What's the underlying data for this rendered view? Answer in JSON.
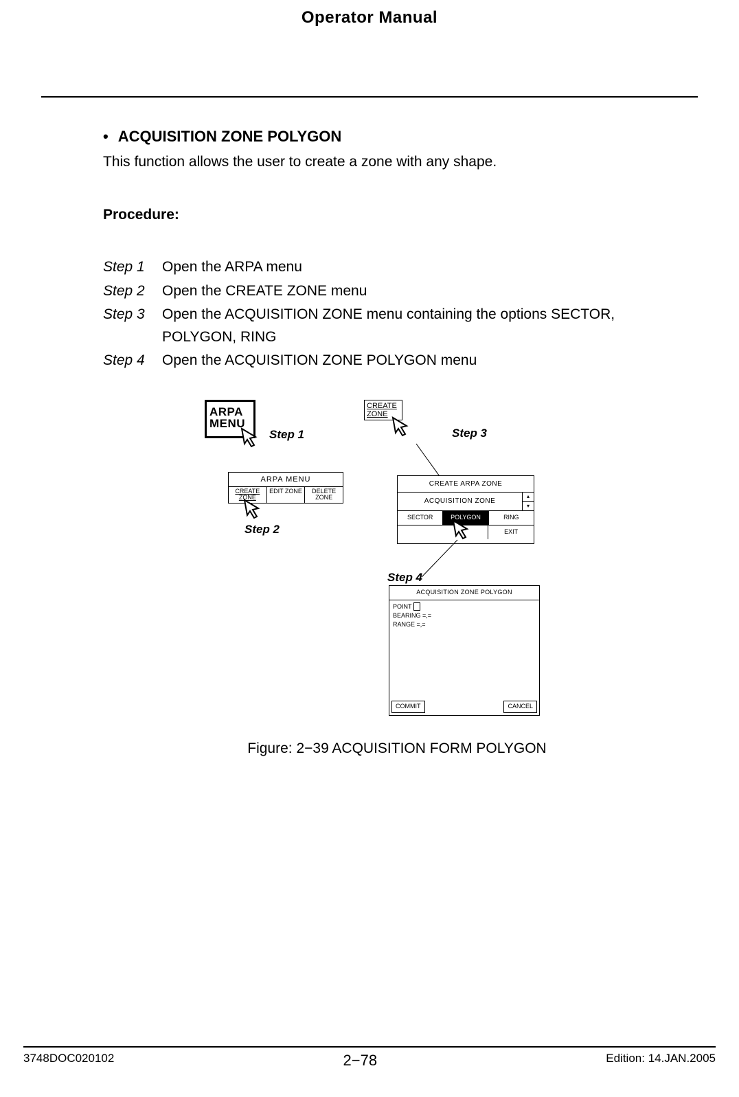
{
  "header": {
    "title": "Operator Manual"
  },
  "section": {
    "bullet_title": "ACQUISITION ZONE POLYGON",
    "intro": "This function allows the user to create a zone with any shape.",
    "procedure_label": "Procedure:",
    "steps": [
      {
        "label": "Step 1",
        "text": "Open the ARPA menu"
      },
      {
        "label": "Step 2",
        "text": "Open the CREATE ZONE menu"
      },
      {
        "label": "Step 3",
        "text": "Open the ACQUISITION ZONE menu containing the options SECTOR, POLYGON, RING"
      },
      {
        "label": "Step 4",
        "text": "Open the ACQUISITION ZONE POLYGON menu"
      }
    ]
  },
  "figure": {
    "arpa_btn_line1": "ARPA",
    "arpa_btn_line2": "MENU",
    "step_labels": {
      "s1": "Step 1",
      "s2": "Step 2",
      "s3": "Step 3",
      "s4": "Step 4"
    },
    "arpa_menu": {
      "title": "ARPA  MENU",
      "cells": [
        "CREATE ZONE",
        "EDIT ZONE",
        "DELETE ZONE"
      ]
    },
    "create_zone_label_line1": "CREATE",
    "create_zone_label_line2": "ZONE",
    "caz": {
      "title": "CREATE ARPA ZONE",
      "acq": "ACQUISITION  ZONE",
      "scroll_up": "▴",
      "scroll_down": "▾",
      "options": [
        "SECTOR",
        "POLYGON",
        "RING"
      ],
      "exit": "EXIT"
    },
    "poly": {
      "title": "ACQUISITION ZONE POLYGON",
      "rows": [
        "POINT",
        "BEARING  =,=",
        "RANGE  =,="
      ],
      "commit": "COMMIT",
      "cancel": "CANCEL"
    },
    "caption": "Figure: 2−39 ACQUISITION FORM POLYGON"
  },
  "footer": {
    "left": "3748DOC020102",
    "center": "2−78",
    "right": "Edition: 14.JAN.2005"
  }
}
